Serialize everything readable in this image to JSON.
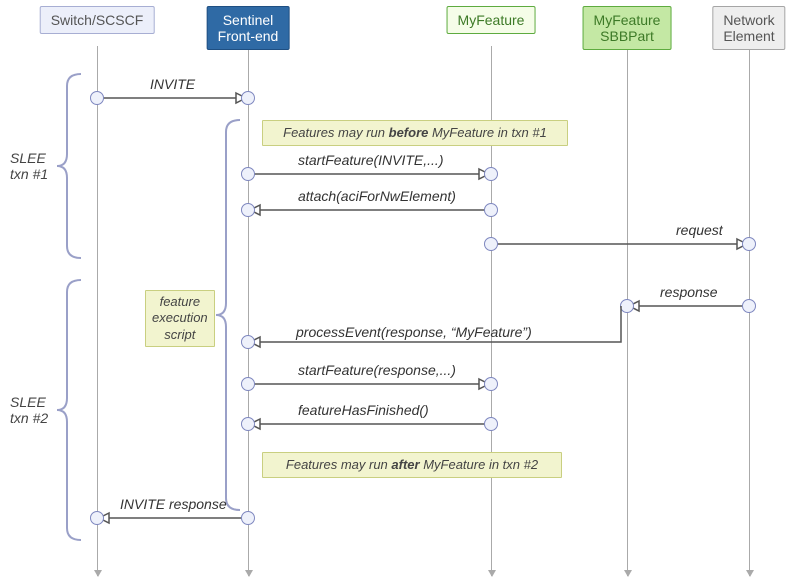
{
  "lanes": {
    "switch": {
      "header1": "Switch/SCSCF"
    },
    "sentinel": {
      "header1": "Sentinel",
      "header2": "Front-end"
    },
    "feature": {
      "header1": "MyFeature"
    },
    "sbbpart": {
      "header1": "MyFeature",
      "header2": "SBBPart"
    },
    "network": {
      "header1": "Network",
      "header2": "Element"
    }
  },
  "messages": {
    "invite": "INVITE",
    "startFeature1": "startFeature(INVITE,...)",
    "attach": "attach(aciForNwElement)",
    "request": "request",
    "response": "response",
    "processEvent": "processEvent(response,  “MyFeature”)",
    "startFeature2": "startFeature(response,...)",
    "featureFinished": "featureHasFinished()",
    "inviteResponse": "INVITE response"
  },
  "notes": {
    "runBefore_pre": "Features may run ",
    "runBefore_bold": "before",
    "runBefore_post": " MyFeature in txn #1",
    "fes_l1": "feature",
    "fes_l2": "execution",
    "fes_l3": "script",
    "runAfter_pre": "Features may run ",
    "runAfter_bold": "after",
    "runAfter_post": " MyFeature in txn #2"
  },
  "braces": {
    "txn1_l1": "SLEE",
    "txn1_l2": "txn #1",
    "txn2_l1": "SLEE",
    "txn2_l2": "txn #2"
  }
}
